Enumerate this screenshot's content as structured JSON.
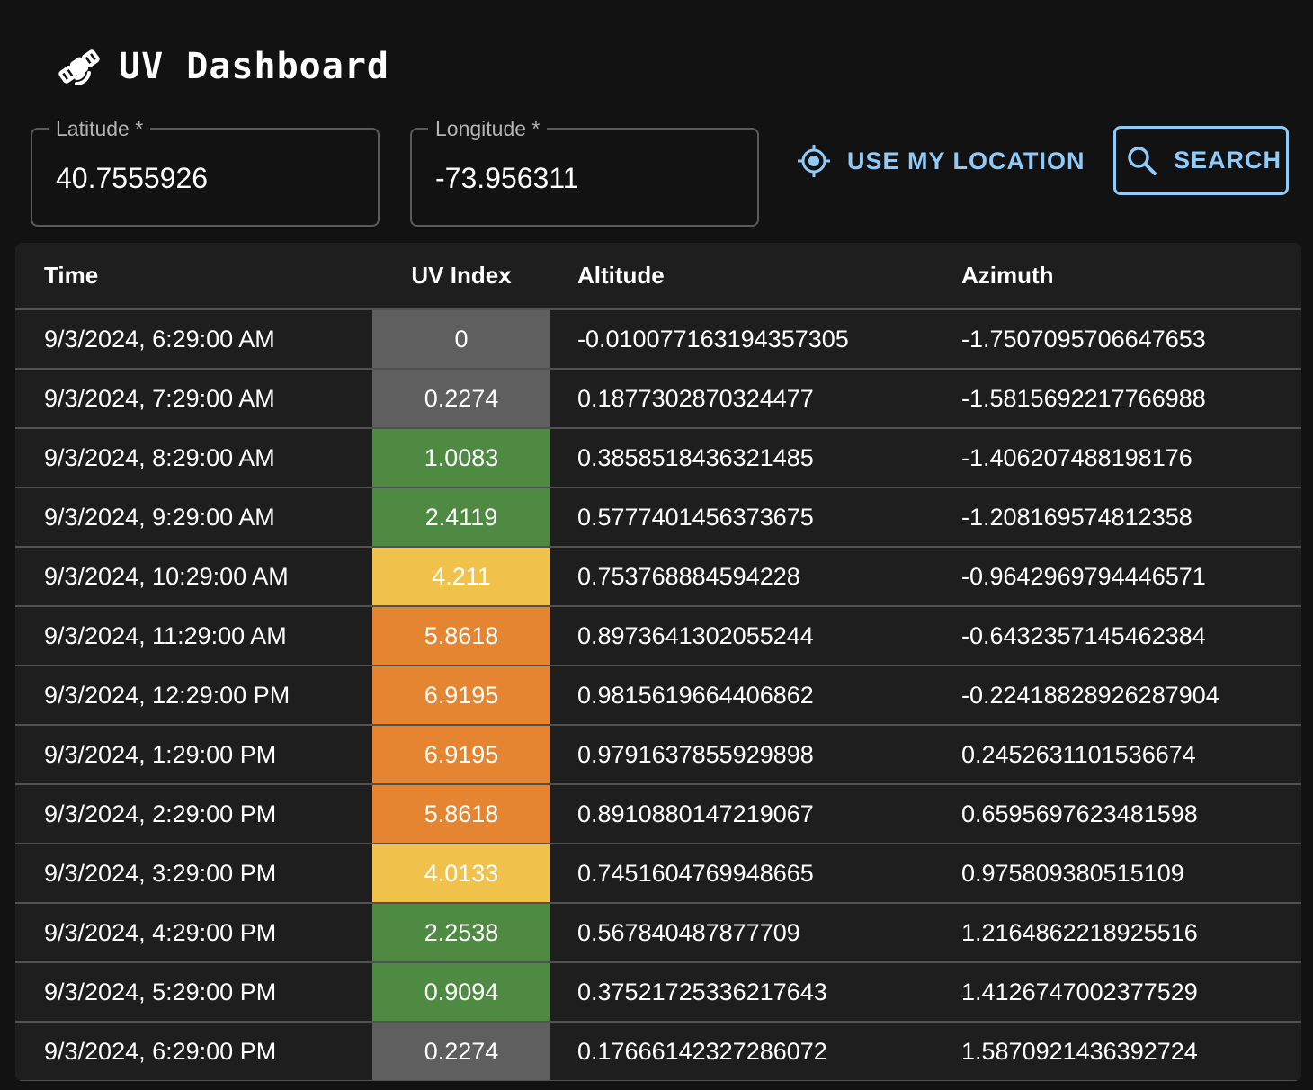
{
  "header": {
    "title": "UV Dashboard",
    "icon": "satellite-icon"
  },
  "form": {
    "latitude": {
      "label": "Latitude *",
      "value": "40.7555926"
    },
    "longitude": {
      "label": "Longitude *",
      "value": "-73.956311"
    },
    "use_location_label": "USE MY LOCATION",
    "search_label": "SEARCH"
  },
  "colors": {
    "accent": "#90caf9",
    "uv_low_gray": "#5f5f5f",
    "uv_green": "#4f8a42",
    "uv_yellow": "#f0c24b",
    "uv_orange": "#e58531"
  },
  "table": {
    "columns": {
      "time": "Time",
      "uv": "UV Index",
      "altitude": "Altitude",
      "azimuth": "Azimuth"
    },
    "rows": [
      {
        "time": "9/3/2024, 6:29:00 AM",
        "uv": "0",
        "uv_color": "#5f5f5f",
        "altitude": "-0.010077163194357305",
        "azimuth": "-1.7507095706647653"
      },
      {
        "time": "9/3/2024, 7:29:00 AM",
        "uv": "0.2274",
        "uv_color": "#5f5f5f",
        "altitude": "0.1877302870324477",
        "azimuth": "-1.5815692217766988"
      },
      {
        "time": "9/3/2024, 8:29:00 AM",
        "uv": "1.0083",
        "uv_color": "#4f8a42",
        "altitude": "0.3858518436321485",
        "azimuth": "-1.406207488198176"
      },
      {
        "time": "9/3/2024, 9:29:00 AM",
        "uv": "2.4119",
        "uv_color": "#4f8a42",
        "altitude": "0.5777401456373675",
        "azimuth": "-1.208169574812358"
      },
      {
        "time": "9/3/2024, 10:29:00 AM",
        "uv": "4.211",
        "uv_color": "#f0c24b",
        "altitude": "0.753768884594228",
        "azimuth": "-0.9642969794446571"
      },
      {
        "time": "9/3/2024, 11:29:00 AM",
        "uv": "5.8618",
        "uv_color": "#e58531",
        "altitude": "0.8973641302055244",
        "azimuth": "-0.6432357145462384"
      },
      {
        "time": "9/3/2024, 12:29:00 PM",
        "uv": "6.9195",
        "uv_color": "#e58531",
        "altitude": "0.9815619664406862",
        "azimuth": "-0.22418828926287904"
      },
      {
        "time": "9/3/2024, 1:29:00 PM",
        "uv": "6.9195",
        "uv_color": "#e58531",
        "altitude": "0.9791637855929898",
        "azimuth": "0.2452631101536674"
      },
      {
        "time": "9/3/2024, 2:29:00 PM",
        "uv": "5.8618",
        "uv_color": "#e58531",
        "altitude": "0.8910880147219067",
        "azimuth": "0.6595697623481598"
      },
      {
        "time": "9/3/2024, 3:29:00 PM",
        "uv": "4.0133",
        "uv_color": "#f0c24b",
        "altitude": "0.7451604769948665",
        "azimuth": "0.975809380515109"
      },
      {
        "time": "9/3/2024, 4:29:00 PM",
        "uv": "2.2538",
        "uv_color": "#4f8a42",
        "altitude": "0.567840487877709",
        "azimuth": "1.2164862218925516"
      },
      {
        "time": "9/3/2024, 5:29:00 PM",
        "uv": "0.9094",
        "uv_color": "#4f8a42",
        "altitude": "0.37521725336217643",
        "azimuth": "1.4126747002377529"
      },
      {
        "time": "9/3/2024, 6:29:00 PM",
        "uv": "0.2274",
        "uv_color": "#5f5f5f",
        "altitude": "0.17666142327286072",
        "azimuth": "1.5870921436392724"
      }
    ]
  }
}
